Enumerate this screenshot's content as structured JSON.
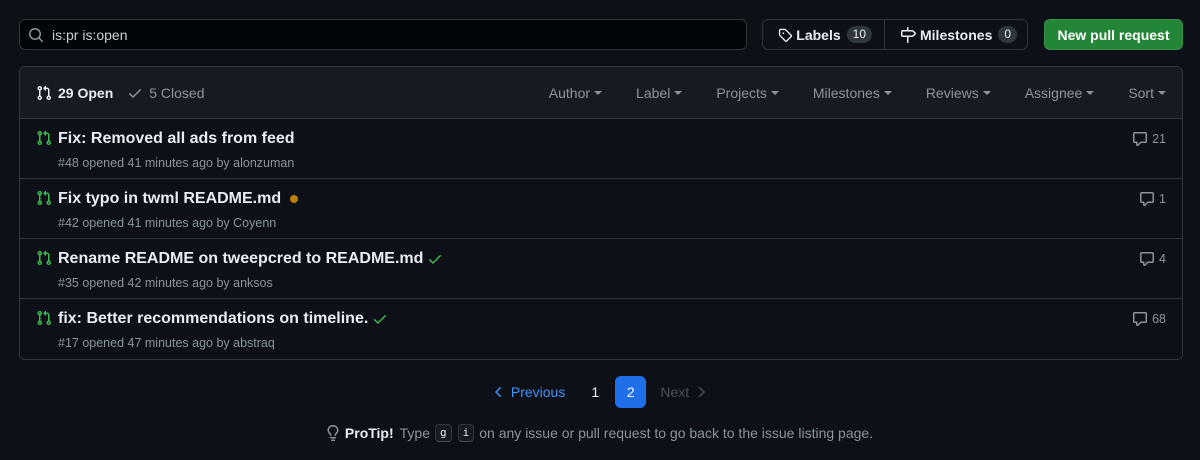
{
  "search": {
    "value": "is:pr is:open"
  },
  "toolbar": {
    "labels_label": "Labels",
    "labels_count": "10",
    "milestones_label": "Milestones",
    "milestones_count": "0",
    "new_pr_label": "New pull request"
  },
  "list_header": {
    "open_label": "29 Open",
    "closed_label": "5 Closed",
    "filters": [
      "Author",
      "Label",
      "Projects",
      "Milestones",
      "Reviews",
      "Assignee",
      "Sort"
    ]
  },
  "pull_requests": [
    {
      "title": "Fix: Removed all ads from feed",
      "meta": "#48 opened 41 minutes ago by alonzuman",
      "comments": "21",
      "status": "none"
    },
    {
      "title": "Fix typo in twml README.md",
      "meta": "#42 opened 41 minutes ago by Coyenn",
      "comments": "1",
      "status": "pending"
    },
    {
      "title": "Rename README on tweepcred to README.md",
      "meta": "#35 opened 42 minutes ago by anksos",
      "comments": "4",
      "status": "success"
    },
    {
      "title": "fix: Better recommendations on timeline.",
      "meta": "#17 opened 47 minutes ago by abstraq",
      "comments": "68",
      "status": "success"
    }
  ],
  "pagination": {
    "previous_label": "Previous",
    "pages": [
      "1",
      "2"
    ],
    "current": "2",
    "next_label": "Next"
  },
  "protip": {
    "bold": "ProTip!",
    "before": "Type",
    "key1": "g",
    "key2": "i",
    "after": "on any issue or pull request to go back to the issue listing page."
  },
  "colors": {
    "background": "#0d1117",
    "open_icon": "#3fb950",
    "primary_button": "#238636",
    "current_page": "#1f6feb",
    "link": "#4493f8",
    "pending_dot": "#bb8009"
  },
  "icons": {
    "search": "search-icon",
    "labels": "tag-icon",
    "milestones": "milestone-icon",
    "open": "git-pull-request-icon",
    "closed": "check-icon",
    "comments": "comment-icon",
    "protip": "light-bulb-icon"
  }
}
